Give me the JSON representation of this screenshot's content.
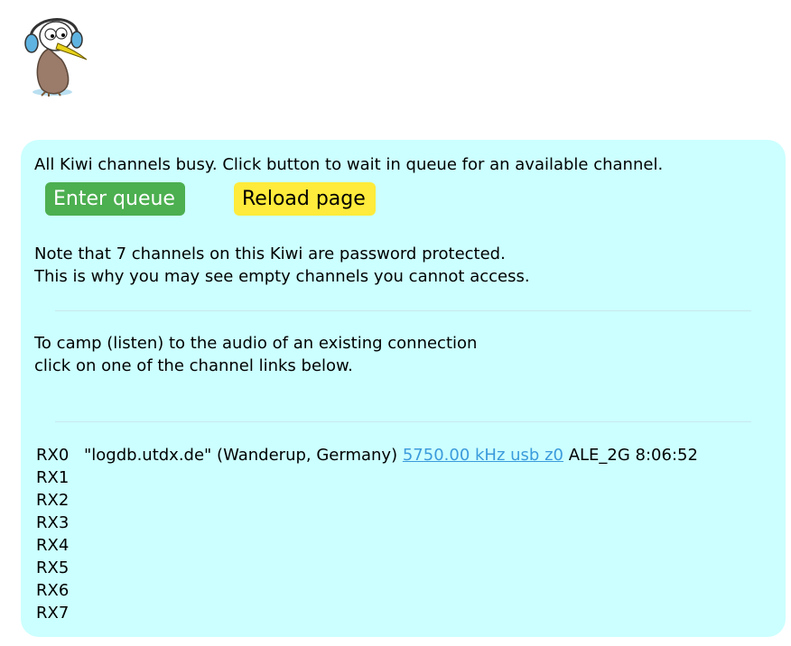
{
  "logo": {
    "icon": "kiwi-bird-headphones-logo"
  },
  "queue": {
    "busy_message": "All Kiwi channels busy. Click button to wait in queue for an available channel.",
    "enter_queue_label": "Enter queue",
    "reload_label": "Reload page"
  },
  "note": {
    "line1": "Note that 7 channels on this Kiwi are password protected.",
    "line2": "This is why you may see empty channels you cannot access."
  },
  "camp": {
    "line1": "To camp (listen) to the audio of an existing connection",
    "line2": "click on one of the channel links below."
  },
  "channels": [
    {
      "label": "RX0",
      "user": "\"logdb.utdx.de\" (Wanderup, Germany)",
      "link": "5750.00 kHz usb z0",
      "extra": "ALE_2G 8:06:52"
    },
    {
      "label": "RX1"
    },
    {
      "label": "RX2"
    },
    {
      "label": "RX3"
    },
    {
      "label": "RX4"
    },
    {
      "label": "RX5"
    },
    {
      "label": "RX6"
    },
    {
      "label": "RX7"
    }
  ],
  "colors": {
    "panel_bg": "#ccffff",
    "enter_queue_bg": "#4caf50",
    "reload_bg": "#ffeb3b",
    "link": "#3b9bdc"
  }
}
